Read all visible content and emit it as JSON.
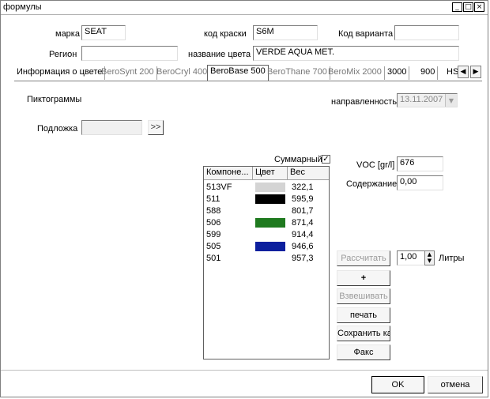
{
  "window": {
    "title": "формулы",
    "btn_min": "_",
    "btn_max": "□",
    "btn_close": "×"
  },
  "header": {
    "marka_label": "марка",
    "marka_value": "SEAT",
    "kod_kraski_label": "код краски",
    "kod_kraski_value": "S6M",
    "kod_varianta_label": "Код варианта",
    "kod_varianta_value": "",
    "region_label": "Регион",
    "region_value": "",
    "color_name_label": "название цвета",
    "color_name_value": "VERDE AQUA MET."
  },
  "tabs": [
    {
      "label": "Информация о цвете"
    },
    {
      "label": "BeroSynt 200"
    },
    {
      "label": "BeroCryl 400"
    },
    {
      "label": "BeroBase 500"
    },
    {
      "label": "BeroThane 700"
    },
    {
      "label": "BeroMix 2000"
    },
    {
      "label": "3000"
    },
    {
      "label": "900"
    },
    {
      "label": "HS"
    }
  ],
  "tab_left_arrow": "◀",
  "tab_right_arrow": "▶",
  "panel": {
    "pictograms_label": "Пиктограммы",
    "napr_label": "направленность",
    "napr_value": "13.11.2007",
    "dropdown_glyph": "▼",
    "podlozhka_label": "Подложка",
    "podlozhka_value": "",
    "browse_label": ">>",
    "summary_label": "Суммарный",
    "summary_check": "✓",
    "voc_label": "VOC [gr/l]",
    "voc_value": "676",
    "content_label": "Содержание",
    "content_value": "0,00"
  },
  "table": {
    "headers": [
      "Компоне...",
      "Цвет",
      "Вес"
    ],
    "rows": [
      {
        "component": "513VF",
        "color": "#d4d4d4",
        "weight": "322,1"
      },
      {
        "component": "511",
        "color": "#000000",
        "weight": "595,9"
      },
      {
        "component": "588",
        "color": "",
        "weight": "801,7"
      },
      {
        "component": "506",
        "color": "#1f7a1f",
        "weight": "871,4"
      },
      {
        "component": "599",
        "color": "",
        "weight": "914,4"
      },
      {
        "component": "505",
        "color": "#0c1f9e",
        "weight": "946,6"
      },
      {
        "component": "501",
        "color": "",
        "weight": "957,3"
      }
    ]
  },
  "actions": {
    "calculate": "Рассчитать",
    "liters_value": "1,00",
    "liters_label": "Литры",
    "spin_up": "▲",
    "spin_down": "▼",
    "plus": "+",
    "weigh": "Взвешивать",
    "print": "печать",
    "save_as": "Сохранить как.",
    "fax": "Факс"
  },
  "footer": {
    "ok": "OK",
    "cancel": "отмена"
  }
}
